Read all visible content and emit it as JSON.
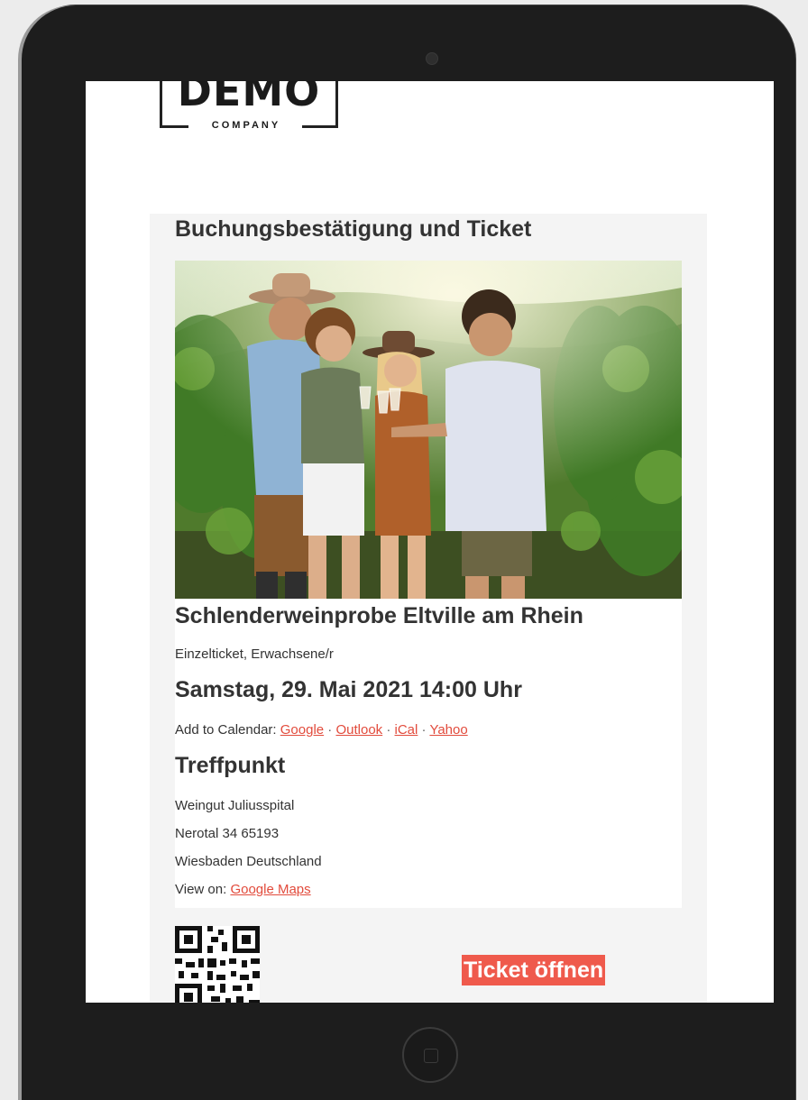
{
  "logo": {
    "word": "DEMO",
    "sub": "COMPANY"
  },
  "card": {
    "title": "Buchungsbestätigung und Ticket"
  },
  "event": {
    "title": "Schlenderweinprobe Eltville am Rhein",
    "ticket_type": "Einzelticket, Erwachsene/r",
    "date": "Samstag, 29. Mai 2021 14:00 Uhr"
  },
  "calendar": {
    "prefix": "Add to Calendar:",
    "separator": "·",
    "links": [
      "Google",
      "Outlook",
      "iCal",
      "Yahoo"
    ]
  },
  "meeting": {
    "title": "Treffpunkt",
    "venue": "Weingut Juliusspital",
    "street": "Nerotal 34 65193",
    "city": "Wiesbaden Deutschland",
    "view_on": "View on:",
    "maps_link": "Google Maps"
  },
  "ticket_button": {
    "label": "Ticket öffnen"
  },
  "colors": {
    "accent": "#e24b3c",
    "button": "#ef5a4c",
    "card_bg": "#f4f4f4",
    "device": "#1d1d1d"
  }
}
